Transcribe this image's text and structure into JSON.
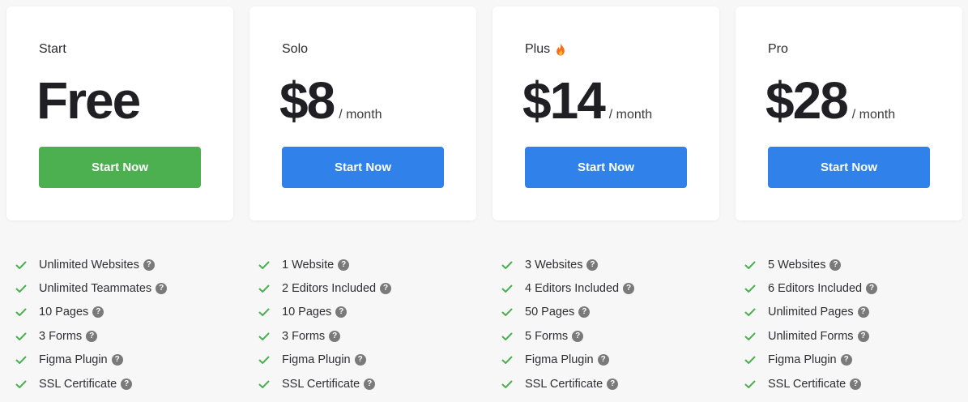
{
  "colors": {
    "background": "#f7f7f7",
    "card": "#ffffff",
    "free_button": "#4caf50",
    "paid_button": "#3081ea",
    "check": "#4caf50",
    "help_icon": "#7a7a7a"
  },
  "icons": {
    "feature_check": "check-icon",
    "feature_help": "help-icon",
    "plus_badge": "flame-icon"
  },
  "plans": [
    {
      "name": "Start",
      "price": "Free",
      "period": "",
      "cta": "Start Now",
      "features": [
        "Unlimited Websites",
        "Unlimited Teammates",
        "10 Pages",
        "3 Forms",
        "Figma Plugin",
        "SSL Certificate"
      ]
    },
    {
      "name": "Solo",
      "price": "$8",
      "period": "/ month",
      "cta": "Start Now",
      "features": [
        "1 Website",
        "2 Editors Included",
        "10 Pages",
        "3 Forms",
        "Figma Plugin",
        "SSL Certificate"
      ]
    },
    {
      "name": "Plus",
      "price": "$14",
      "period": "/ month",
      "cta": "Start Now",
      "features": [
        "3 Websites",
        "4 Editors Included",
        "50 Pages",
        "5 Forms",
        "Figma Plugin",
        "SSL Certificate"
      ]
    },
    {
      "name": "Pro",
      "price": "$28",
      "period": "/ month",
      "cta": "Start Now",
      "features": [
        "5 Websites",
        "6 Editors Included",
        "Unlimited Pages",
        "Unlimited Forms",
        "Figma Plugin",
        "SSL Certificate"
      ]
    }
  ]
}
